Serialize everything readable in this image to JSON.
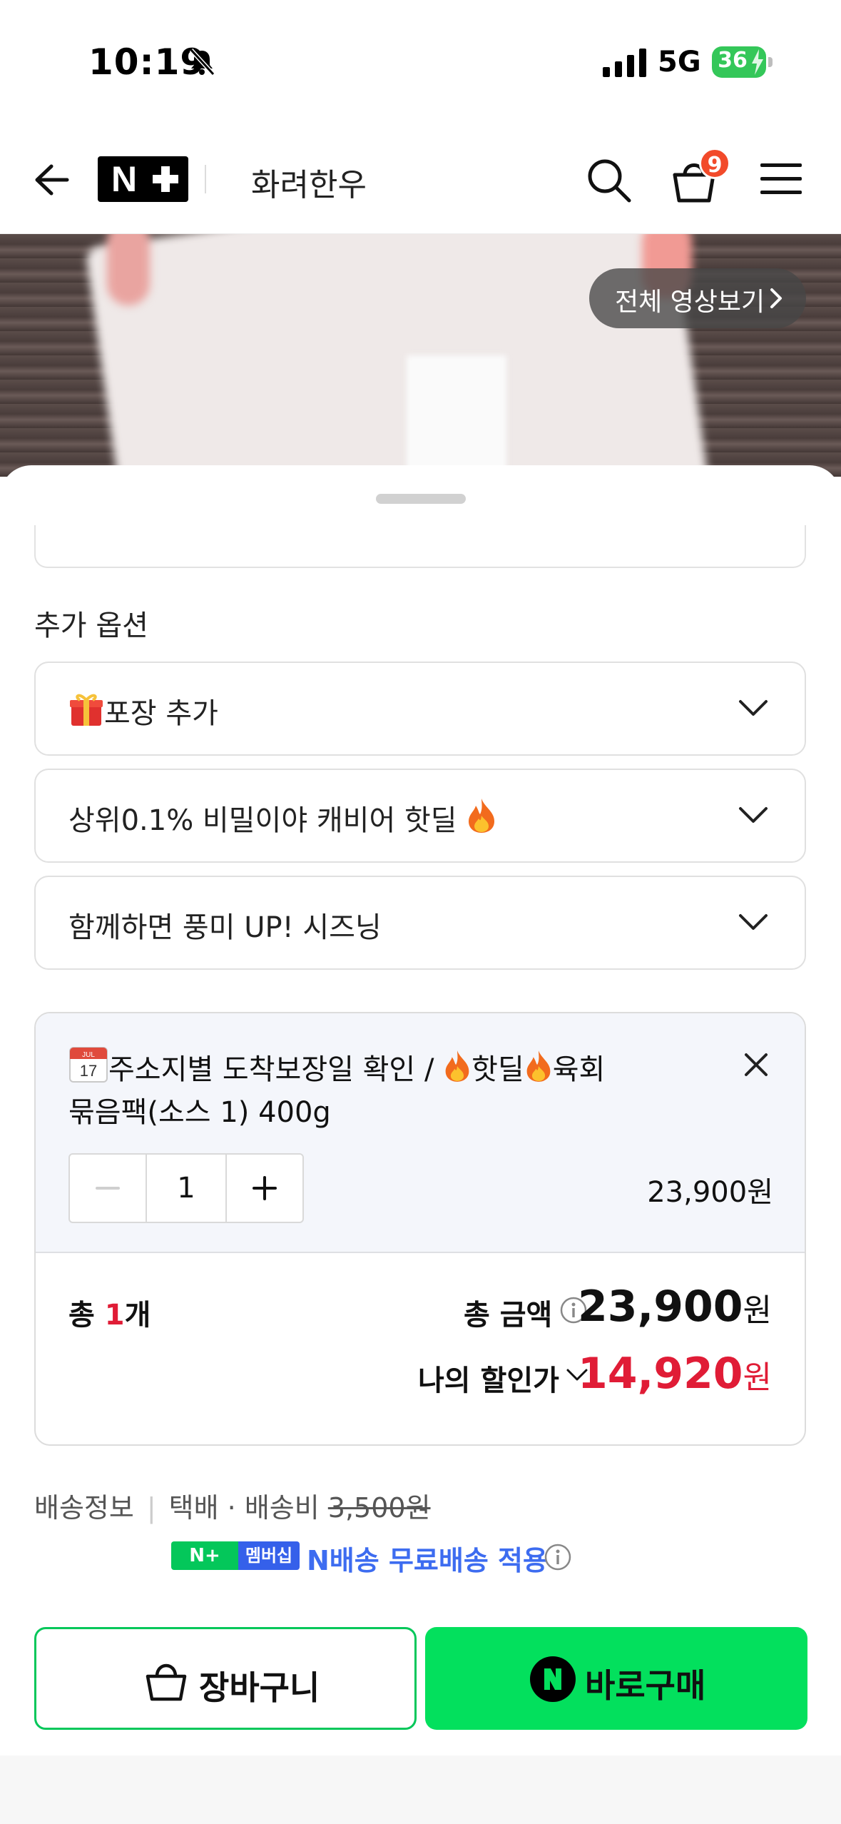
{
  "status_bar": {
    "time": "10:19",
    "network": "5G",
    "battery": "36"
  },
  "header": {
    "logo": "N+",
    "store_name": "화려한우",
    "cart_count": "9"
  },
  "banner": {
    "video_button_label": "전체 영상보기"
  },
  "options_section": {
    "title": "추가 옵션",
    "items": [
      {
        "label": "포장 추가",
        "icon": "gift-icon"
      },
      {
        "label": "상위0.1% 비밀이야 캐비어 핫딜",
        "icon": "fire-icon"
      },
      {
        "label": "함께하면 풍미 UP! 시즈닝"
      }
    ]
  },
  "selected_item": {
    "title_part1": "주소지별 도착보장일 확인 / ",
    "title_part2": "핫딜",
    "title_part3": "육회",
    "title_line2": "묶음팩(소스 1) 400g",
    "calendar_day": "17",
    "calendar_month": "JUL",
    "quantity": "1",
    "price": "23,900원"
  },
  "summary": {
    "count_prefix": "총 ",
    "count_value": "1",
    "count_suffix": "개",
    "total_label": "총 금액",
    "total_amount": "23,900",
    "won": "원",
    "discount_label": "나의 할인가",
    "discount_amount": "14,920"
  },
  "shipping": {
    "label": "배송정보",
    "method": "택배 · 배송비",
    "fee": "3,500원",
    "badge_n_plus": "N+",
    "badge_membership": "멤버십",
    "membership_text": "N배송 무료배송 적용"
  },
  "buttons": {
    "cart": "장바구니",
    "buy": "바로구매"
  },
  "colors": {
    "naver_green": "#03e05d",
    "price_red": "#e01c36",
    "membership_blue": "#3560ea"
  }
}
